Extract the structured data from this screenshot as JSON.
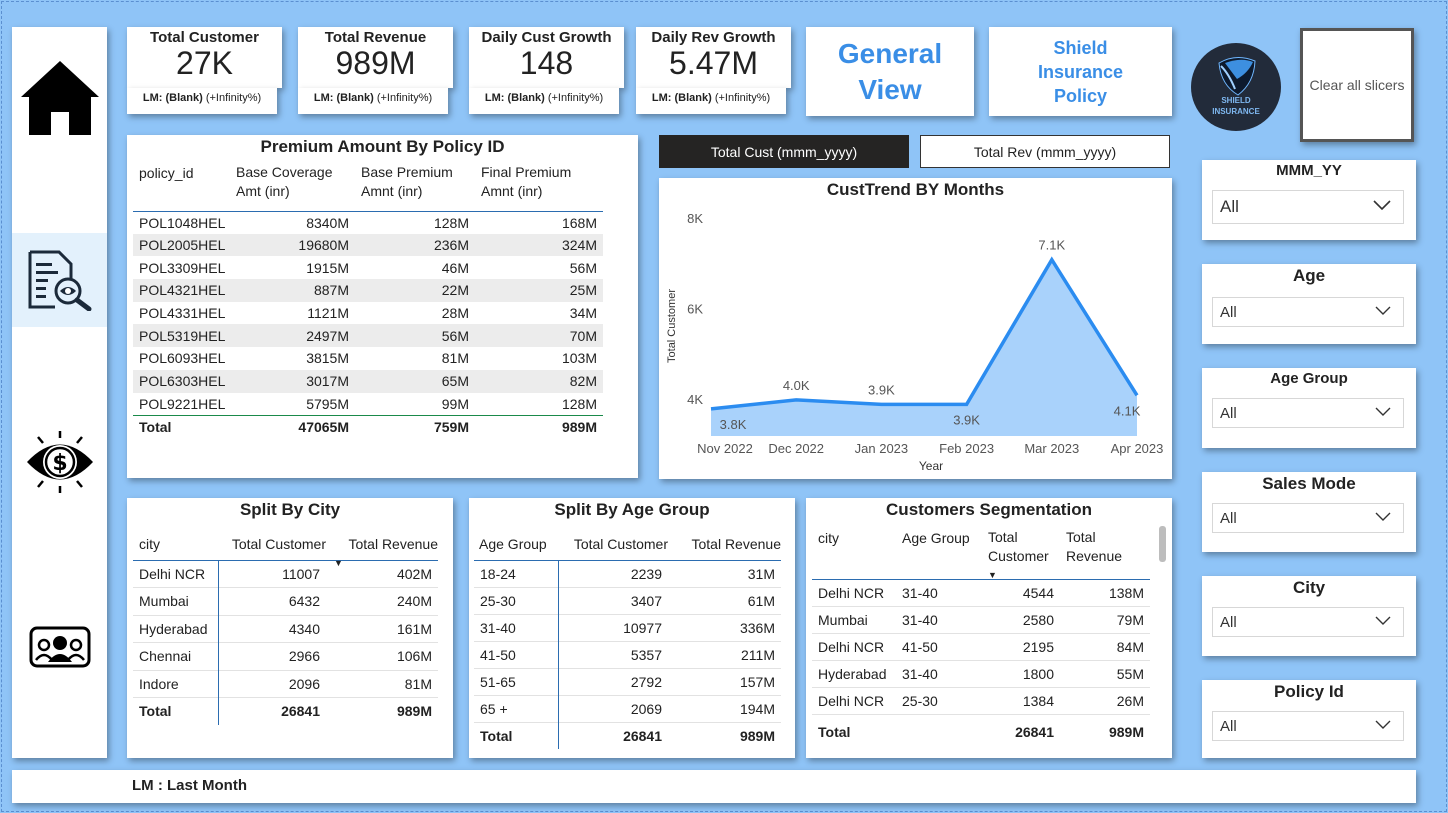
{
  "nav": {
    "icons": [
      "home-icon",
      "report-search-icon",
      "money-eye-icon",
      "team-icon"
    ]
  },
  "kpis": [
    {
      "title": "Total Customer",
      "value": "27K",
      "lm_label": "LM: (Blank)",
      "lm_pct": "(+Infinity%)"
    },
    {
      "title": "Total Revenue",
      "value": "989M",
      "lm_label": "LM: (Blank)",
      "lm_pct": "(+Infinity%)"
    },
    {
      "title": "Daily Cust Growth",
      "value": "148",
      "lm_label": "LM: (Blank)",
      "lm_pct": "(+Infinity%)"
    },
    {
      "title": "Daily Rev Growth",
      "value": "5.47M",
      "lm_label": "LM: (Blank)",
      "lm_pct": "(+Infinity%)"
    }
  ],
  "header": {
    "general_view": "General View",
    "policy_title": "Shield Insurance Policy",
    "logo_text": "SHIELD INSURANCE",
    "clear_slicers": "Clear all slicers"
  },
  "premium_table": {
    "title": "Premium Amount By Policy ID",
    "columns": [
      "policy_id",
      "Base Coverage Amt (inr)",
      "Base Premium Amnt (inr)",
      "Final Premium Amnt (inr)"
    ],
    "rows": [
      [
        "POL1048HEL",
        "8340M",
        "128M",
        "168M"
      ],
      [
        "POL2005HEL",
        "19680M",
        "236M",
        "324M"
      ],
      [
        "POL3309HEL",
        "1915M",
        "46M",
        "56M"
      ],
      [
        "POL4321HEL",
        "887M",
        "22M",
        "25M"
      ],
      [
        "POL4331HEL",
        "1121M",
        "28M",
        "34M"
      ],
      [
        "POL5319HEL",
        "2497M",
        "56M",
        "70M"
      ],
      [
        "POL6093HEL",
        "3815M",
        "81M",
        "103M"
      ],
      [
        "POL6303HEL",
        "3017M",
        "65M",
        "82M"
      ],
      [
        "POL9221HEL",
        "5795M",
        "99M",
        "128M"
      ]
    ],
    "total": [
      "Total",
      "47065M",
      "759M",
      "989M"
    ]
  },
  "tabs": {
    "cust": "Total Cust (mmm_yyyy)",
    "rev": "Total Rev (mmm_yyyy)"
  },
  "chart_data": {
    "type": "area",
    "title": "CustTrend BY Months",
    "xlabel": "Year",
    "ylabel": "Total Customer",
    "categories": [
      "Nov 2022",
      "Dec 2022",
      "Jan 2023",
      "Feb 2023",
      "Mar 2023",
      "Apr 2023"
    ],
    "values": [
      3800,
      4000,
      3900,
      3900,
      7100,
      4100
    ],
    "data_labels": [
      "3.8K",
      "4.0K",
      "3.9K",
      "3.9K",
      "7.1K",
      "4.1K"
    ],
    "y_ticks": [
      "4K",
      "6K",
      "8K"
    ],
    "ylim": [
      3200,
      8200
    ],
    "color": "#2b8cf0",
    "fill": "#a9d2fb"
  },
  "city_table": {
    "title": "Split By City",
    "columns": [
      "city",
      "Total Customer",
      "Total Revenue"
    ],
    "rows": [
      [
        "Delhi NCR",
        "11007",
        "402M"
      ],
      [
        "Mumbai",
        "6432",
        "240M"
      ],
      [
        "Hyderabad",
        "4340",
        "161M"
      ],
      [
        "Chennai",
        "2966",
        "106M"
      ],
      [
        "Indore",
        "2096",
        "81M"
      ]
    ],
    "total": [
      "Total",
      "26841",
      "989M"
    ]
  },
  "age_table": {
    "title": "Split By Age Group",
    "columns": [
      "Age Group",
      "Total Customer",
      "Total Revenue"
    ],
    "rows": [
      [
        "18-24",
        "2239",
        "31M"
      ],
      [
        "25-30",
        "3407",
        "61M"
      ],
      [
        "31-40",
        "10977",
        "336M"
      ],
      [
        "41-50",
        "5357",
        "211M"
      ],
      [
        "51-65",
        "2792",
        "157M"
      ],
      [
        "65 +",
        "2069",
        "194M"
      ]
    ],
    "total": [
      "Total",
      "26841",
      "989M"
    ]
  },
  "seg_table": {
    "title": "Customers Segmentation",
    "columns": [
      "city",
      "Age Group",
      "Total Customer",
      "Total Revenue"
    ],
    "rows": [
      [
        "Delhi NCR",
        "31-40",
        "4544",
        "138M"
      ],
      [
        "Mumbai",
        "31-40",
        "2580",
        "79M"
      ],
      [
        "Delhi NCR",
        "41-50",
        "2195",
        "84M"
      ],
      [
        "Hyderabad",
        "31-40",
        "1800",
        "55M"
      ],
      [
        "Delhi NCR",
        "25-30",
        "1384",
        "26M"
      ]
    ],
    "total": [
      "Total",
      "",
      "26841",
      "989M"
    ]
  },
  "slicers": [
    {
      "title": "MMM_YY",
      "value": "All"
    },
    {
      "title": "Age",
      "value": "All"
    },
    {
      "title": "Age Group",
      "value": "All"
    },
    {
      "title": "Sales Mode",
      "value": "All"
    },
    {
      "title": "City",
      "value": "All"
    },
    {
      "title": "Policy Id",
      "value": "All"
    }
  ],
  "footer": {
    "note": "LM : Last Month"
  }
}
